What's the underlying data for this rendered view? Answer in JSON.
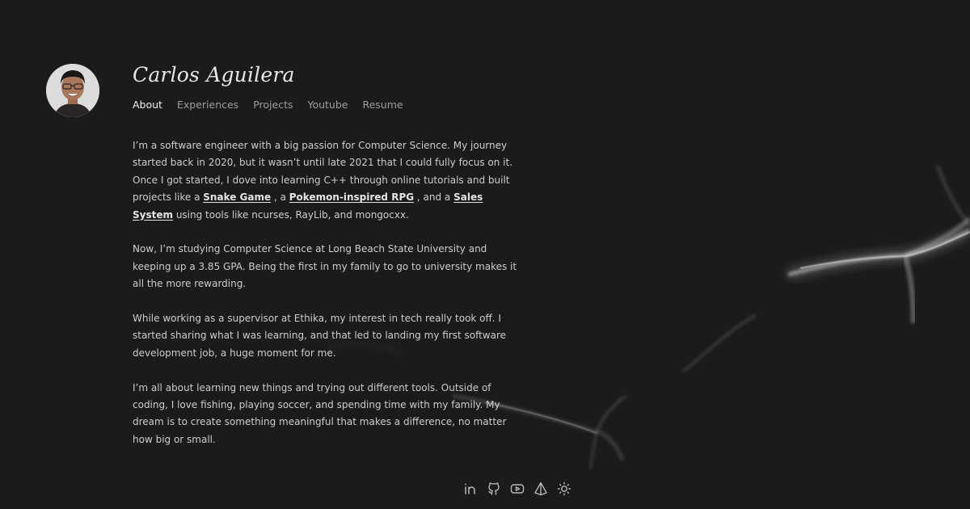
{
  "profile": {
    "name": "Carlos Aguilera",
    "avatar_alt": "Carlos Aguilera"
  },
  "nav": [
    {
      "label": "About",
      "active": true
    },
    {
      "label": "Experiences",
      "active": false
    },
    {
      "label": "Projects",
      "active": false
    },
    {
      "label": "Youtube",
      "active": false
    },
    {
      "label": "Resume",
      "active": false
    }
  ],
  "about": {
    "p1": {
      "before": "I’m a software engineer with a big passion for Computer Science. My journey started back in 2020, but it wasn’t until late 2021 that I could fully focus on it. Once I got started, I dove into learning C++ through online tutorials and built projects like a ",
      "link1": "Snake Game",
      "mid1": " , a ",
      "link2": "Pokemon-inspired RPG",
      "mid2": " , and a ",
      "link3": "Sales System",
      "after": " using tools like ncurses, RayLib, and mongocxx."
    },
    "p2": "Now, I’m studying Computer Science at Long Beach State University and keeping up a 3.85 GPA. Being the first in my family to go to university makes it all the more rewarding.",
    "p3": "While working as a supervisor at Ethika, my interest in tech really took off. I started sharing what I was learning, and that led to landing my first software development job, a huge moment for me.",
    "p4": "I’m all about learning new things and trying out different tools. Outside of coding, I love fishing, playing soccer, and spending time with my family. My dream is to create something meaningful that makes a difference, no matter how big or small."
  },
  "footer_icons": [
    "linkedin-icon",
    "github-icon",
    "youtube-icon",
    "prism-icon",
    "sun-icon"
  ],
  "colors": {
    "background": "#1c1a1b",
    "text": "#cfcccc",
    "nav_inactive": "#9f9c9d",
    "nav_active": "#f0eeee"
  }
}
